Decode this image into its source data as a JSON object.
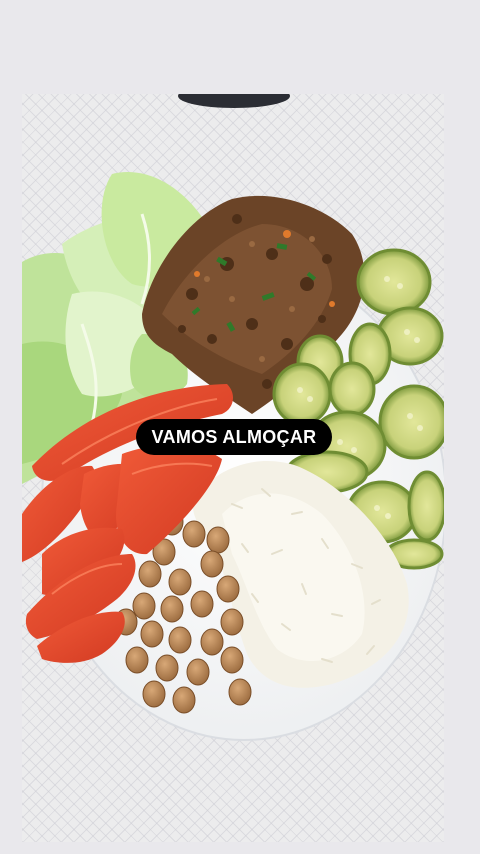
{
  "story": {
    "caption": "VAMOS ALMOÇAR"
  },
  "colors": {
    "background": "#e9e8ec",
    "caption_background": "#000000",
    "caption_text": "#ffffff"
  }
}
